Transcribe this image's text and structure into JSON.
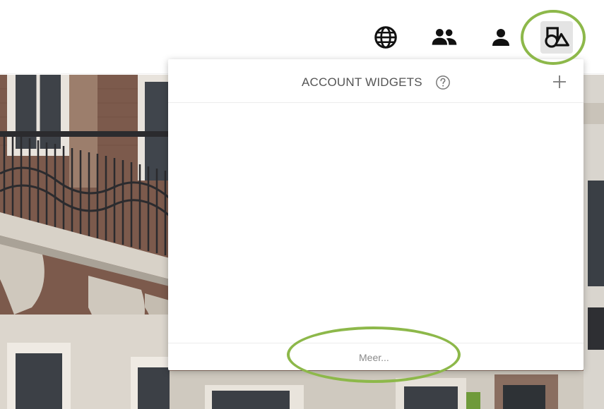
{
  "header": {
    "icons": [
      {
        "name": "globe-icon"
      },
      {
        "name": "group-icon"
      },
      {
        "name": "person-icon"
      },
      {
        "name": "widgets-icon"
      }
    ]
  },
  "panel": {
    "title": "ACCOUNT WIDGETS",
    "help_icon": "help-circle-icon",
    "add_icon": "plus-icon",
    "more_label": "Meer..."
  },
  "colors": {
    "highlight": "#8db84a",
    "active_button_bg": "#e4e4e4",
    "title_text": "#555555",
    "link_text": "#8a8a8a"
  }
}
